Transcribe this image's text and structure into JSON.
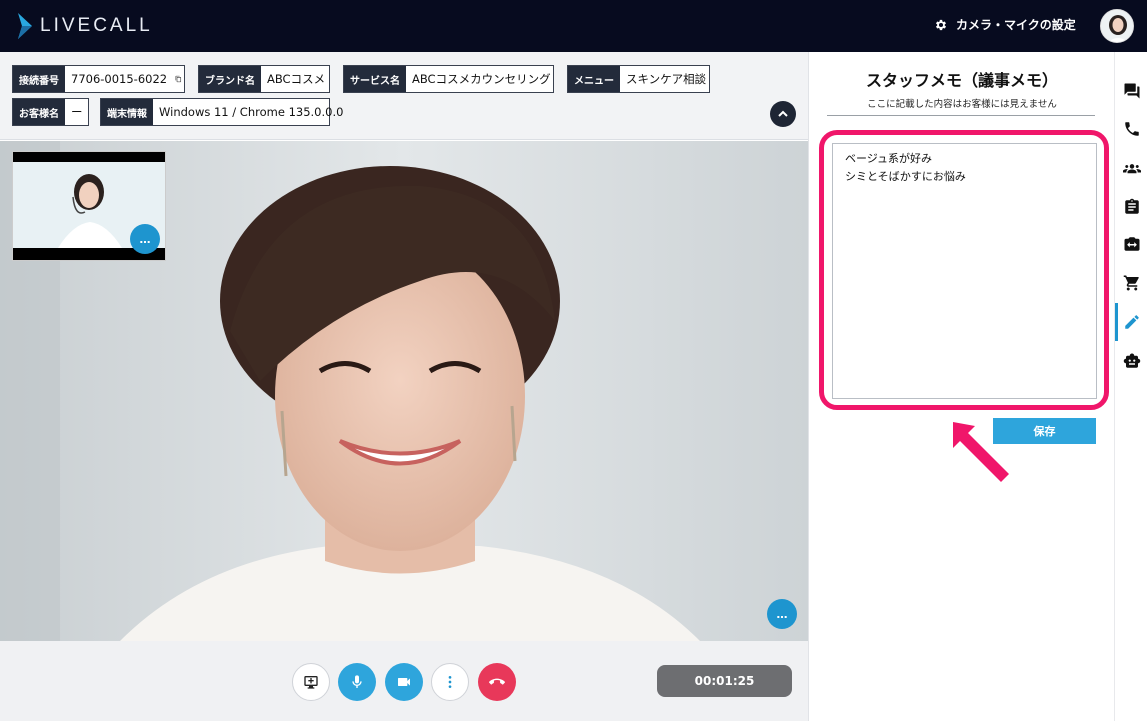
{
  "app": {
    "logo_text": "LIVECALL",
    "accent": "#1e95cf",
    "highlight": "#f0166a"
  },
  "header": {
    "settings_label": "カメラ・マイクの設定"
  },
  "info": {
    "connection_label": "接続番号",
    "connection_value": "7706-0015-6022",
    "brand_label": "ブランド名",
    "brand_value": "ABCコスメ",
    "service_label": "サービス名",
    "service_value": "ABCコスメカウンセリング",
    "menu_label": "メニュー",
    "menu_value": "スキンケア相談",
    "customer_label": "お客様名",
    "customer_value": "ー",
    "device_label": "端末情報",
    "device_value": "Windows 11 / Chrome 135.0.0.0"
  },
  "video": {
    "more_label": "…"
  },
  "controls": {
    "timer": "00:01:25"
  },
  "panel": {
    "title": "スタッフメモ（議事メモ）",
    "subtitle": "ここに記載した内容はお客様には見えません",
    "memo_text": "ベージュ系が好み\nシミとそばかすにお悩み",
    "save_label": "保存"
  },
  "rail": {
    "icons": [
      "chat-icon",
      "phone-icon",
      "people-icon",
      "clipboard-icon",
      "camera-switch-icon",
      "cart-icon",
      "pencil-icon",
      "robot-icon"
    ]
  }
}
